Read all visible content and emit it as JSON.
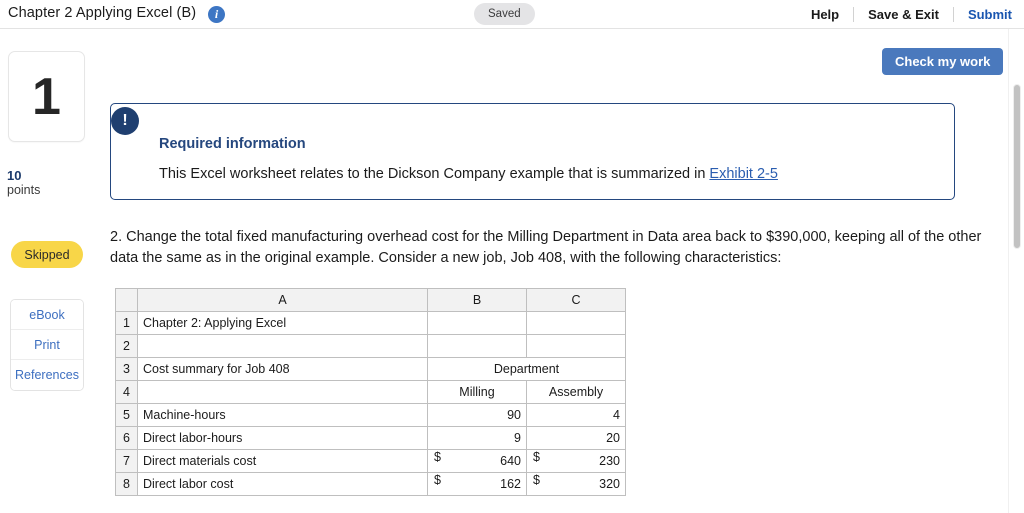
{
  "topbar": {
    "title": "Chapter 2 Applying Excel (B)",
    "info_icon": "info-icon",
    "saved_status": "Saved",
    "help_label": "Help",
    "save_exit_label": "Save & Exit",
    "submit_label": "Submit",
    "submit_color": "#1a56b0"
  },
  "sidebar": {
    "question_number": "1",
    "points_value": "10",
    "points_label": "points",
    "status_badge": "Skipped",
    "status_badge_color": "#f8d648",
    "resources": [
      {
        "label": "eBook"
      },
      {
        "label": "Print"
      },
      {
        "label": "References"
      }
    ]
  },
  "main": {
    "check_my_work_label": "Check my work",
    "check_my_work_color": "#4a79bd",
    "banner": {
      "icon": "exclamation-icon",
      "title": "Required information",
      "text_before_link": "This Excel worksheet relates to the Dickson Company example that is summarized in ",
      "link_label": "Exhibit 2-5",
      "border_color": "#24477f"
    },
    "question_text": "2. Change the total fixed manufacturing overhead cost for the Milling Department in Data area back to $390,000, keeping all of the other data the same as in the original example. Consider a new job, Job 408, with the following characteristics:"
  },
  "spreadsheet": {
    "column_headers": [
      "",
      "A",
      "B",
      "C"
    ],
    "rows": [
      {
        "num": "1",
        "a": "Chapter 2: Applying Excel",
        "a_style": "purple-bold",
        "b": "",
        "c": ""
      },
      {
        "num": "2",
        "a": "",
        "b": "",
        "c": ""
      },
      {
        "num": "3",
        "a": "Cost summary for Job 408",
        "a_style": "bold",
        "merged_bc": "Department",
        "merged_style": "bold-center"
      },
      {
        "num": "4",
        "a": "",
        "b": "Milling",
        "c": "Assembly",
        "b_style": "center",
        "c_style": "center"
      },
      {
        "num": "5",
        "a": "Machine-hours",
        "b": "90",
        "c": "4",
        "b_style": "right",
        "c_style": "right"
      },
      {
        "num": "6",
        "a": "Direct labor-hours",
        "b": "9",
        "c": "20",
        "b_style": "right",
        "c_style": "right"
      },
      {
        "num": "7",
        "a": "Direct materials cost",
        "b": "640",
        "c": "230",
        "b_style": "money",
        "c_style": "money",
        "currency": "$"
      },
      {
        "num": "8",
        "a": "Direct labor cost",
        "b": "162",
        "c": "320",
        "b_style": "money",
        "c_style": "money",
        "currency": "$"
      }
    ]
  }
}
